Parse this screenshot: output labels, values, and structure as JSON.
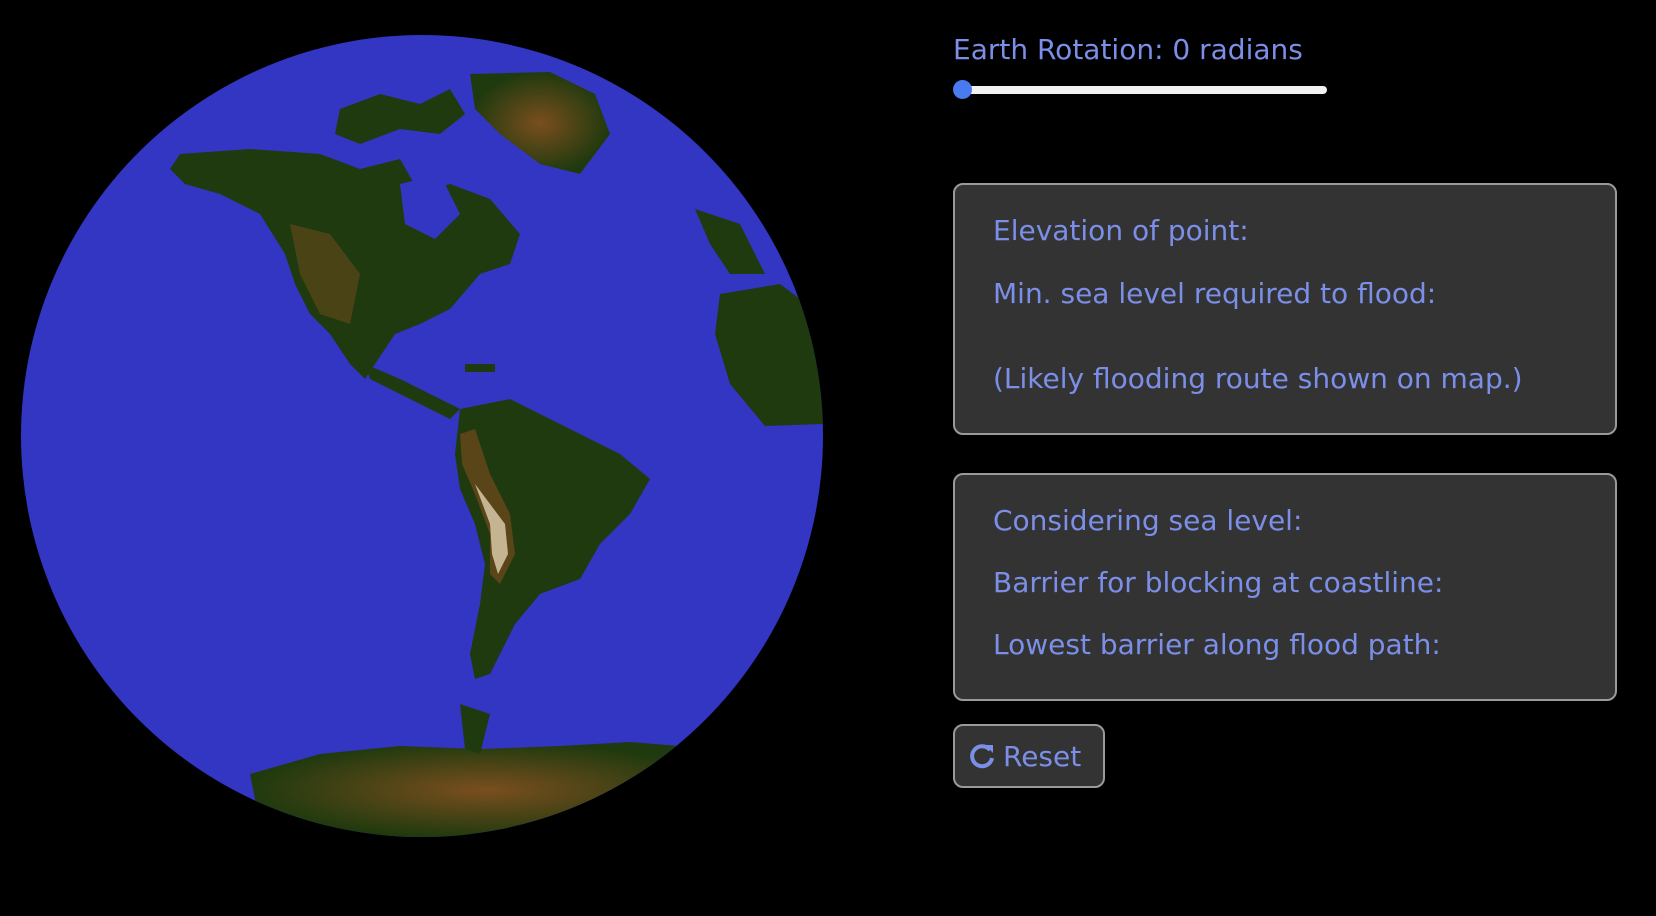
{
  "rotation": {
    "label": "Earth Rotation: 0 radians",
    "value": 0
  },
  "point_info": {
    "elevation_label": "Elevation of point:",
    "min_sea_level_label": "Min. sea level required to flood:",
    "route_note": "(Likely flooding route shown on map.)"
  },
  "sea_info": {
    "considering_label": "Considering sea level:",
    "barrier_coastline_label": "Barrier for blocking at coastline:",
    "lowest_barrier_label": "Lowest barrier along flood path:"
  },
  "reset": {
    "label": "Reset",
    "icon": "refresh-icon"
  },
  "colors": {
    "background": "#000000",
    "ocean": "#3236c2",
    "land": "#1f3a0e",
    "highland": "#6e4a1c",
    "peaks": "#d8c8a8",
    "text_accent": "#7b8fe8",
    "panel_bg": "#333333",
    "panel_border": "#9a9a9a",
    "slider_thumb": "#4a7af0",
    "slider_track": "#f2f2f2"
  }
}
